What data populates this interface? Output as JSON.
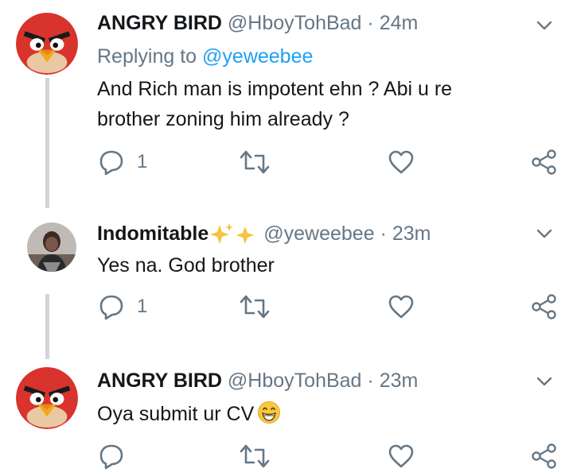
{
  "tweets": [
    {
      "name": "ANGRY BIRD",
      "handle": "@HboyTohBad",
      "separator": "·",
      "time": "24m",
      "replying_prefix": "Replying to",
      "replying_mention": "@yeweebee",
      "text_line1": "And Rich man is impotent ehn ? Abi u re",
      "text_line2": "brother zoning him already ?",
      "reply_count": "1",
      "avatar": "angry-bird-avatar"
    },
    {
      "name": "Indomitable",
      "handle": "@yeweebee",
      "separator": "·",
      "time": "23m",
      "text_line1": "Yes na. God brother",
      "reply_count": "1",
      "avatar": "user-photo-avatar",
      "name_decoration": "sparkles-emoji"
    },
    {
      "name": "ANGRY BIRD",
      "handle": "@HboyTohBad",
      "separator": "·",
      "time": "23m",
      "text_line1": "Oya submit ur CV",
      "reply_count": "",
      "avatar": "angry-bird-avatar",
      "text_emoji": "grinning-face-emoji"
    }
  ],
  "colors": {
    "text": "#14171a",
    "secondary": "#657786",
    "link": "#1da1f2",
    "thread_line": "#cfd6dc",
    "bird_red": "#d32f2f"
  }
}
